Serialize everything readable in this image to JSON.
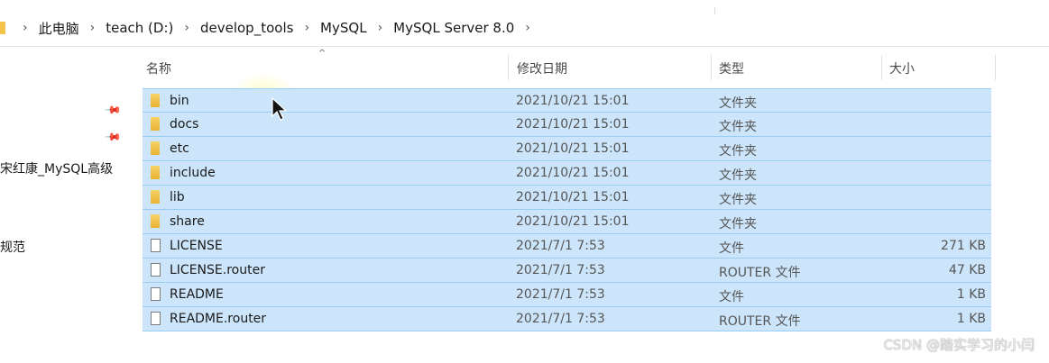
{
  "breadcrumb": {
    "items": [
      "此电脑",
      "teach (D:)",
      "develop_tools",
      "MySQL",
      "MySQL Server 8.0"
    ],
    "separator": "›"
  },
  "nav": {
    "items": [
      "宋红康_MySQL高级",
      "规范"
    ]
  },
  "columns": {
    "name": "名称",
    "date": "修改日期",
    "type": "类型",
    "size": "大小"
  },
  "files": [
    {
      "icon": "folder-icon",
      "name": "bin",
      "date": "2021/10/21 15:01",
      "type": "文件夹",
      "size": ""
    },
    {
      "icon": "folder-icon",
      "name": "docs",
      "date": "2021/10/21 15:01",
      "type": "文件夹",
      "size": ""
    },
    {
      "icon": "folder-icon",
      "name": "etc",
      "date": "2021/10/21 15:01",
      "type": "文件夹",
      "size": ""
    },
    {
      "icon": "folder-icon",
      "name": "include",
      "date": "2021/10/21 15:01",
      "type": "文件夹",
      "size": ""
    },
    {
      "icon": "folder-icon",
      "name": "lib",
      "date": "2021/10/21 15:01",
      "type": "文件夹",
      "size": ""
    },
    {
      "icon": "folder-icon",
      "name": "share",
      "date": "2021/10/21 15:01",
      "type": "文件夹",
      "size": ""
    },
    {
      "icon": "file-icon",
      "name": "LICENSE",
      "date": "2021/7/1 7:53",
      "type": "文件",
      "size": "271 KB"
    },
    {
      "icon": "file-icon",
      "name": "LICENSE.router",
      "date": "2021/7/1 7:53",
      "type": "ROUTER 文件",
      "size": "47 KB"
    },
    {
      "icon": "file-icon",
      "name": "README",
      "date": "2021/7/1 7:53",
      "type": "文件",
      "size": "1 KB"
    },
    {
      "icon": "file-icon",
      "name": "README.router",
      "date": "2021/7/1 7:53",
      "type": "ROUTER 文件",
      "size": "1 KB"
    }
  ],
  "colors": {
    "selection": "#cce5fb",
    "selection_border": "#99cdf5",
    "folder": "#f2c24a"
  },
  "watermark": "CSDN @踏实学习的小闫"
}
